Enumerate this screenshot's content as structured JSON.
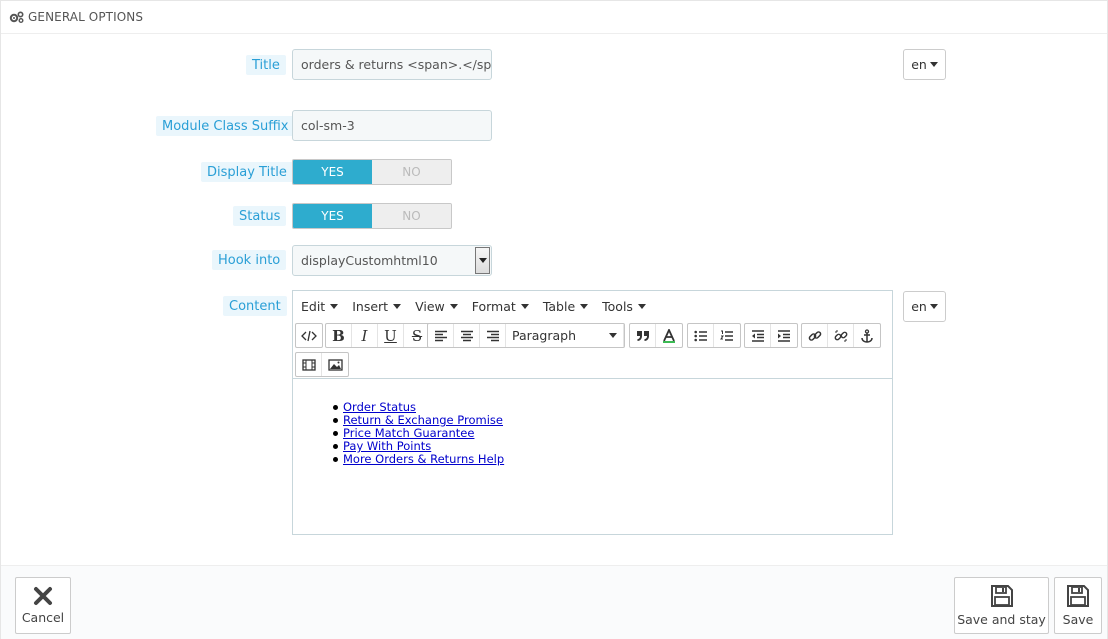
{
  "panel": {
    "heading": "GENERAL OPTIONS"
  },
  "form": {
    "title_label": "Title",
    "title_value": "orders & returns <span>.</span>",
    "lang": "en",
    "suffix_label": "Module Class Suffix",
    "suffix_value": "col-sm-3",
    "display_title_label": "Display Title",
    "status_label": "Status",
    "yes": "YES",
    "no": "NO",
    "hook_label": "Hook into",
    "hook_value": "displayCustomhtml10",
    "content_label": "Content"
  },
  "editor": {
    "menus": [
      "Edit",
      "Insert",
      "View",
      "Format",
      "Table",
      "Tools"
    ],
    "block_format": "Paragraph",
    "links": [
      "Order Status",
      "Return & Exchange Promise",
      "Price Match Guarantee",
      "Pay With Points",
      "More Orders & Returns Help"
    ]
  },
  "footer": {
    "cancel": "Cancel",
    "save_stay": "Save and stay",
    "save": "Save"
  },
  "colors": {
    "label_text": "#2a9fd6",
    "switch_on": "#2eacce"
  }
}
